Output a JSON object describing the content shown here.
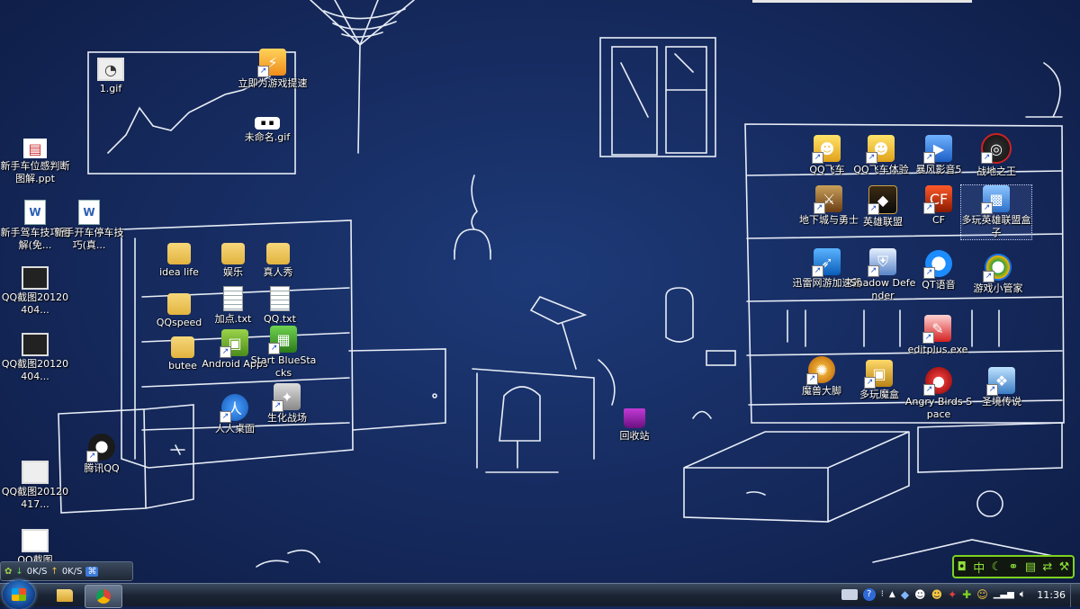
{
  "desktop_icons": {
    "gif_1": "1.gif",
    "game_accel": "立即为游戏提速",
    "unnamed_gif": "未命名.gif",
    "ppt_file": "新手车位感判断图解.ppt",
    "doc_drive": "新手驾车技巧图解(免...",
    "doc_park": "新手开车停车技巧(真...",
    "qq_shot_1": "QQ截图20120404...",
    "qq_shot_2": "QQ截图20120404...",
    "qq_shot_3": "QQ截图20120417...",
    "qq_shot_4": "QQ截图",
    "tencent_qq": "腾讯QQ",
    "idea_life": "idea life",
    "yule": "娱乐",
    "zhenrenxiu": "真人秀",
    "qqspeed": "QQspeed",
    "jiadian": "加点.txt",
    "qq_txt": "QQ.txt",
    "butee": "butee",
    "android_apps": "Android Apps",
    "bluestacks": "Start BlueStacks",
    "renren": "人人桌面",
    "shenghua": "生化战场",
    "qq_feiche": "QQ飞车",
    "qq_feiche_tiyan": "QQ飞车体验",
    "baofeng": "暴风影音5",
    "zhandi": "战地之王",
    "dnf": "地下城与勇士",
    "lol": "英雄联盟",
    "cf": "CF",
    "duowan_box": "多玩英雄联盟盒子",
    "xunlei_accel": "迅雷网游加速器",
    "shadow_defender": "Shadow Defender",
    "yy_voice": "QT语音",
    "game_butler": "游戏小管家",
    "editplus": "editplus.exe",
    "moshou": "魔兽大脚",
    "duowan_mohe": "多玩魔盒",
    "angry_birds": "Angry Birds Space",
    "shengjing": "圣境传说",
    "recycle_bin": "回收站"
  },
  "speed_widget": {
    "down": "0K/S",
    "up": "0K/S"
  },
  "taskbar": {
    "clock": "11:36"
  },
  "colors": {
    "wallpaper": "#15285a",
    "chalk": "#e8edf6",
    "gadget_accent": "#7ed321"
  }
}
